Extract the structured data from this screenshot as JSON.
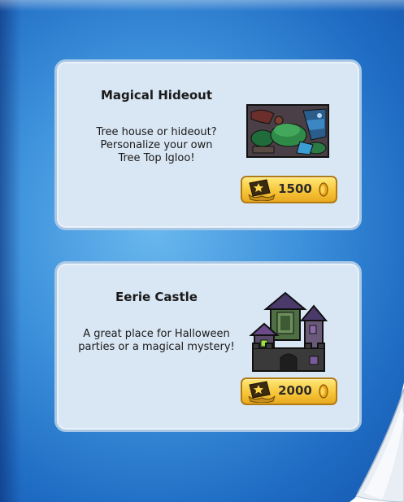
{
  "catalog": {
    "items": [
      {
        "title": "Magical Hideout",
        "description_lines": [
          "Tree house or hideout?",
          "Personalize your own",
          "Tree Top Igloo!"
        ],
        "price": "1500",
        "thumbnail_icon": "treetop-igloo-thumbnail",
        "coin_icon": "coin-icon"
      },
      {
        "title": "Eerie Castle",
        "description_lines": [
          "A great place for Halloween",
          "parties or a magical mystery!"
        ],
        "price": "2000",
        "thumbnail_icon": "castle-igloo-thumbnail",
        "coin_icon": "coin-icon"
      }
    ]
  },
  "colors": {
    "page_blue": "#3f93dc",
    "card_bg": "#d9e6f3",
    "price_gold": "#f7c63a"
  }
}
